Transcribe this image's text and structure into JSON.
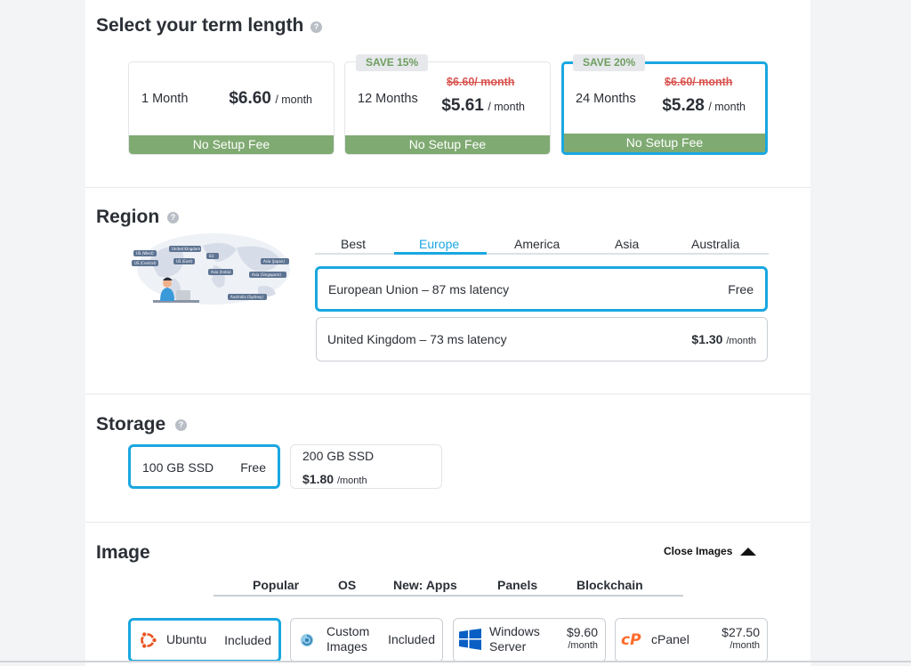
{
  "term": {
    "title": "Select your term length",
    "help": "?",
    "options": [
      {
        "period": "1 Month",
        "price": "$6.60",
        "unit": "/ month",
        "fee": "No Setup Fee"
      },
      {
        "period": "12 Months",
        "badge": "SAVE 15%",
        "old_price": "$6.60/ month",
        "price": "$5.61",
        "unit": "/ month",
        "fee": "No Setup Fee"
      },
      {
        "period": "24 Months",
        "badge": "SAVE 20%",
        "old_price": "$6.60/ month",
        "price": "$5.28",
        "unit": "/ month",
        "fee": "No Setup Fee",
        "selected": true
      }
    ]
  },
  "region": {
    "title": "Region",
    "help": "?",
    "map_labels": [
      "US (West)",
      "US (Central)",
      "US (East)",
      "United Kingdom",
      "EU",
      "Asia (Japan)",
      "Asia (India)",
      "Asia (Singapore)",
      "Australia (Sydney)"
    ],
    "tabs": [
      "Best",
      "Europe",
      "America",
      "Asia",
      "Australia"
    ],
    "active_tab": "Europe",
    "options": [
      {
        "name": "European Union",
        "sep": "–",
        "latency": "87 ms latency",
        "price": "Free",
        "unit": "",
        "selected": true
      },
      {
        "name": "United Kingdom",
        "sep": "–",
        "latency": "73 ms latency",
        "price": "$1.30",
        "unit": "/month"
      }
    ]
  },
  "storage": {
    "title": "Storage",
    "help": "?",
    "options": [
      {
        "name": "100 GB SSD",
        "price": "Free",
        "selected": true
      },
      {
        "name": "200 GB SSD",
        "price": "$1.80",
        "unit": "/month"
      }
    ]
  },
  "image": {
    "title": "Image",
    "close_label": "Close Images",
    "tabs": [
      "Popular",
      "OS",
      "New: Apps",
      "Panels",
      "Blockchain"
    ],
    "options": [
      {
        "name": "Ubuntu",
        "price": "Included",
        "icon": "ubuntu-icon",
        "selected": true
      },
      {
        "name_line1": "Custom",
        "name_line2": "Images",
        "price": "Included",
        "icon": "custom-images-icon"
      },
      {
        "name_line1": "Windows",
        "name_line2": "Server",
        "price": "$9.60",
        "unit": "/month",
        "icon": "windows-icon"
      },
      {
        "name": "cPanel",
        "price": "$27.50",
        "unit": "/month",
        "icon": "cpanel-icon"
      }
    ]
  },
  "colors": {
    "accent": "#1aa7e0",
    "fee_green": "#7faa72",
    "strike_red": "#d9534f",
    "save_text": "#6e9e5f"
  }
}
